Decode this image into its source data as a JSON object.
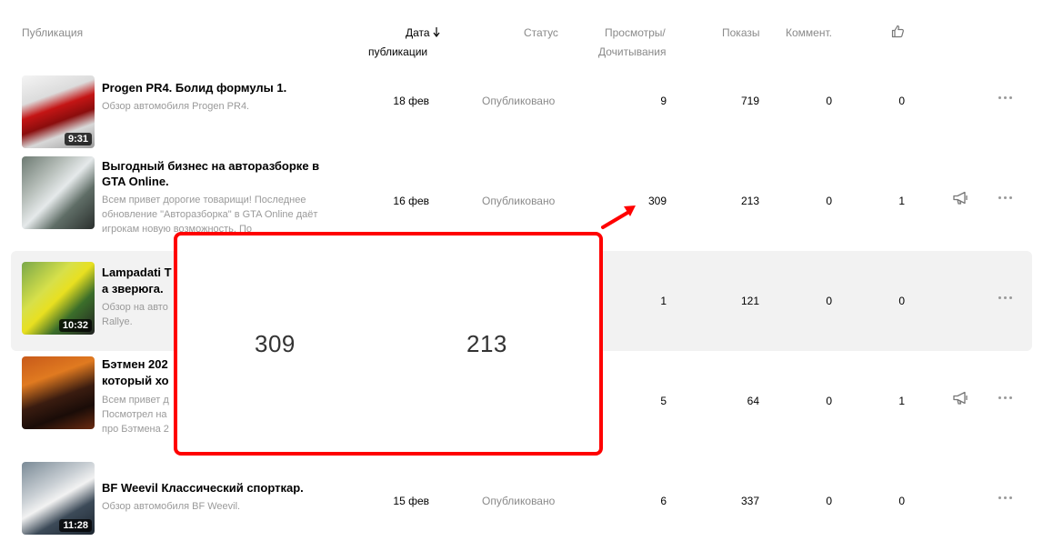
{
  "headers": {
    "publication": "Публикация",
    "date_line1": "Дата",
    "date_sort_icon": "arrow-down-icon",
    "date_line2": "публикации",
    "status": "Статус",
    "views_line1": "Просмотры/",
    "views_line2": "Дочитывания",
    "impressions": "Показы",
    "comments": "Коммент.",
    "likes_icon": "thumbs-up-icon"
  },
  "rows": [
    {
      "title": "Progen PR4. Болид формулы 1.",
      "desc": "Обзор автомобиля Progen PR4.",
      "duration": "9:31",
      "date": "18 фев",
      "status": "Опубликовано",
      "views": "9",
      "impressions": "719",
      "comments": "0",
      "likes": "0",
      "promote": false
    },
    {
      "title": "Выгодный бизнес на авторазборке в GTA Online.",
      "desc": "Всем привет дорогие товарищи! Последнее обновление \"Авторазборка\" в GTA Online даёт игрокам новую возможность. По",
      "duration": "",
      "date": "16 фев",
      "status": "Опубликовано",
      "views": "309",
      "impressions": "213",
      "comments": "0",
      "likes": "1",
      "promote": true
    },
    {
      "title": "Lampadati T",
      "title2": "а зверюга.",
      "desc": "Обзор на авто",
      "desc2": "Rallye.",
      "duration": "10:32",
      "date": "",
      "status": "",
      "views": "1",
      "impressions": "121",
      "comments": "0",
      "likes": "0",
      "promote": false
    },
    {
      "title": "Бэтмен 202",
      "title2": "который хо",
      "desc": "Всем привет д",
      "desc2": "Посмотрел на",
      "desc3": "про Бэтмена 2",
      "duration": "",
      "date": "",
      "status": "",
      "views": "5",
      "impressions": "64",
      "comments": "0",
      "likes": "1",
      "promote": true
    },
    {
      "title": "BF Weevil Классический спорткар.",
      "desc": "Обзор автомобиля BF Weevil.",
      "duration": "11:28",
      "date": "15 фев",
      "status": "Опубликовано",
      "views": "6",
      "impressions": "337",
      "comments": "0",
      "likes": "0",
      "promote": false
    }
  ],
  "zoom": {
    "left_value": "309",
    "right_value": "213"
  },
  "colors": {
    "highlight_border": "#ff0000",
    "row_hover": "#f2f2f2",
    "muted_text": "#8a8a8a"
  }
}
